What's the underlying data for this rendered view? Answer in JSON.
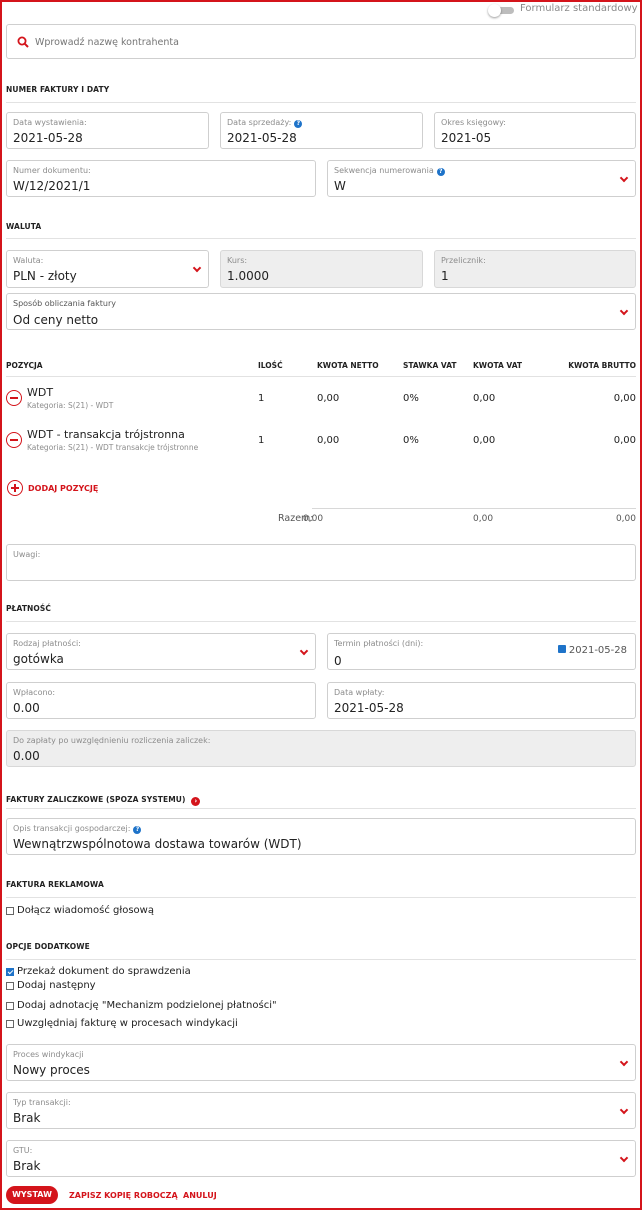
{
  "toggle": {
    "label": "Formularz standardowy"
  },
  "search": {
    "placeholder": "Wprowadź nazwę kontrahenta"
  },
  "sections": {
    "invoice": "NUMER FAKTURY I DATY",
    "currency": "WALUTA",
    "payment": "PŁATNOŚĆ",
    "advance": "FAKTURY ZALICZKOWE (SPOZA SYSTEMU)",
    "claim": "FAKTURA REKLAMOWA",
    "options": "OPCJE DODATKOWE"
  },
  "fields": {
    "issue_date": {
      "label": "Data wystawienia:",
      "value": "2021-05-28"
    },
    "sale_date": {
      "label": "Data sprzedaży:",
      "value": "2021-05-28"
    },
    "period": {
      "label": "Okres księgowy:",
      "value": "2021-05"
    },
    "doc_number": {
      "label": "Numer dokumentu:",
      "value": "W/12/2021/1"
    },
    "sequence": {
      "label": "Sekwencja numerowania",
      "value": "W"
    },
    "currency": {
      "label": "Waluta:",
      "value": "PLN - złoty"
    },
    "rate": {
      "label": "Kurs:",
      "value": "1.0000"
    },
    "multiplier": {
      "label": "Przelicznik:",
      "value": "1"
    },
    "calc_method": {
      "label": "Sposób obliczania faktury",
      "value": "Od ceny netto"
    },
    "notes": {
      "label": "Uwagi:",
      "value": ""
    },
    "payment_type": {
      "label": "Rodzaj płatności:",
      "value": "gotówka"
    },
    "payment_term": {
      "label": "Termin płatności (dni):",
      "value": "0",
      "date": "2021-05-28"
    },
    "paid": {
      "label": "Wpłacono:",
      "value": "0.00"
    },
    "paid_date": {
      "label": "Data wpłaty:",
      "value": "2021-05-28"
    },
    "to_pay": {
      "label": "Do zapłaty po uwzględnieniu rozliczenia zaliczek:",
      "value": "0.00"
    },
    "transaction_desc": {
      "label": "Opis transakcji gospodarczej:",
      "value": "Wewnątrzwspólnotowa dostawa towarów  (WDT)"
    },
    "recovery": {
      "label": "Proces windykacji",
      "value": "Nowy proces"
    },
    "transaction_type": {
      "label": "Typ transakcji:",
      "value": "Brak"
    },
    "gtu": {
      "label": "GTU:",
      "value": "Brak"
    }
  },
  "table": {
    "headers": {
      "position": "POZYCJA",
      "qty": "ILOŚĆ",
      "net": "KWOTA NETTO",
      "vat_rate": "STAWKA VAT",
      "vat": "KWOTA VAT",
      "gross": "KWOTA BRUTTO"
    },
    "rows": [
      {
        "name": "WDT",
        "category": "Kategoria: S(21) - WDT",
        "qty": "1",
        "net": "0,00",
        "vat_rate": "0%",
        "vat": "0,00",
        "gross": "0,00"
      },
      {
        "name": "WDT - transakcja trójstronna",
        "category": "Kategoria: S(21) - WDT transakcje trójstronne",
        "qty": "1",
        "net": "0,00",
        "vat_rate": "0%",
        "vat": "0,00",
        "gross": "0,00"
      }
    ],
    "add_label": "DODAJ POZYCJĘ",
    "total_label": "Razem:",
    "total_net": "0,00",
    "total_vat": "0,00",
    "total_gross": "0,00"
  },
  "checkboxes": {
    "voice": {
      "label": "Dołącz wiadomość głosową",
      "checked": false
    },
    "review": {
      "label": "Przekaż dokument do sprawdzenia",
      "checked": true
    },
    "add_next": {
      "label": "Dodaj następny",
      "checked": false
    },
    "split": {
      "label": "Dodaj adnotację \"Mechanizm podzielonej płatności\"",
      "checked": false
    },
    "recovery": {
      "label": "Uwzględniaj fakturę w procesach windykacji",
      "checked": false
    }
  },
  "buttons": {
    "issue": "WYSTAW",
    "draft": "ZAPISZ KOPIĘ ROBOCZĄ",
    "cancel": "ANULUJ"
  },
  "colors": {
    "accent": "#d4141b",
    "info": "#1e73c9"
  }
}
